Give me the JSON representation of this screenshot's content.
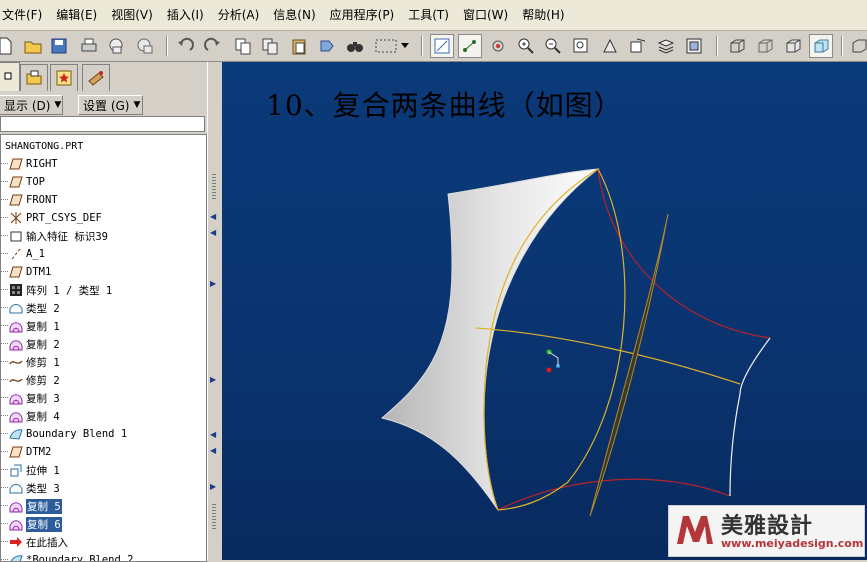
{
  "menubar": {
    "items": [
      "文件(F)",
      "编辑(E)",
      "视图(V)",
      "插入(I)",
      "分析(A)",
      "信息(N)",
      "应用程序(P)",
      "工具(T)",
      "窗口(W)",
      "帮助(H)"
    ]
  },
  "left_panel": {
    "show_label": "显示 (D)",
    "settings_label": "设置 (G)",
    "root_label": "SHANGTONG.PRT",
    "tree_items": [
      {
        "label": "RIGHT",
        "icon": "datum-plane-icon"
      },
      {
        "label": "TOP",
        "icon": "datum-plane-icon"
      },
      {
        "label": "FRONT",
        "icon": "datum-plane-icon"
      },
      {
        "label": "PRT_CSYS_DEF",
        "icon": "csys-icon"
      },
      {
        "label": "输入特征 标识39",
        "icon": "import-feature-icon"
      },
      {
        "label": "A_1",
        "icon": "axis-icon"
      },
      {
        "label": "DTM1",
        "icon": "datum-plane-icon"
      },
      {
        "label": "阵列 1 / 类型 1",
        "icon": "pattern-icon"
      },
      {
        "label": "类型 2",
        "icon": "surface-icon"
      },
      {
        "label": "复制 1",
        "icon": "copy-surface-icon"
      },
      {
        "label": "复制 2",
        "icon": "copy-surface-icon"
      },
      {
        "label": "修剪 1",
        "icon": "trim-icon"
      },
      {
        "label": "修剪 2",
        "icon": "trim-icon"
      },
      {
        "label": "复制 3",
        "icon": "copy-surface-icon"
      },
      {
        "label": "复制 4",
        "icon": "copy-surface-icon"
      },
      {
        "label": "Boundary Blend 1",
        "icon": "boundary-blend-icon"
      },
      {
        "label": "DTM2",
        "icon": "datum-plane-icon"
      },
      {
        "label": "拉伸 1",
        "icon": "extrude-icon"
      },
      {
        "label": "类型 3",
        "icon": "surface-icon"
      },
      {
        "label": "复制 5",
        "icon": "copy-surface-icon",
        "selected": true
      },
      {
        "label": "复制 6",
        "icon": "copy-surface-icon",
        "selected": true
      },
      {
        "label": "在此插入",
        "icon": "insert-here-icon"
      },
      {
        "label": "*Boundary Blend 2",
        "icon": "boundary-blend-icon"
      }
    ]
  },
  "viewport": {
    "title": "10、复合两条曲线（如图）"
  },
  "watermark": {
    "name": "美雅設計",
    "url": "www.meiyadesign.com"
  },
  "colors": {
    "viewport_bg": "#0a3470",
    "selection": "#2c5d9a",
    "curve_yellow": "#e0b12a",
    "edge_red": "#b8222a"
  }
}
